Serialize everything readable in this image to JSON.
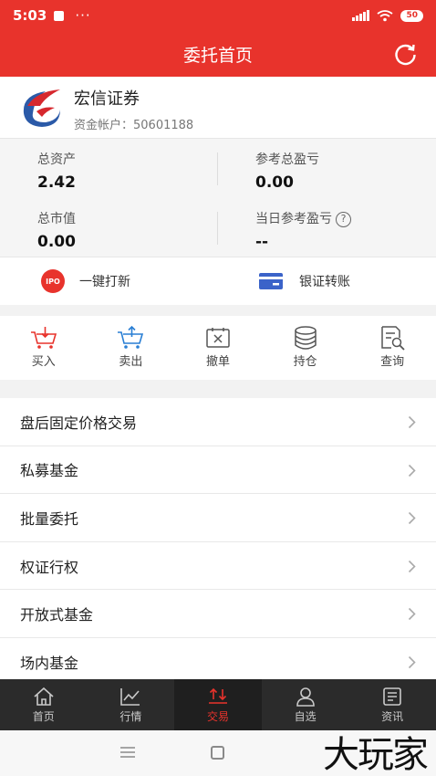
{
  "status_bar": {
    "time": "5:03",
    "dots": "···",
    "battery": "50"
  },
  "header": {
    "title": "委托首页",
    "refresh_icon": "refresh-icon"
  },
  "account": {
    "broker_name": "宏信证券",
    "account_label": "资金帐户：",
    "account_number": "50601188"
  },
  "summary": {
    "total_assets_label": "总资产",
    "total_assets_value": "2.42",
    "total_pnl_label": "参考总盈亏",
    "total_pnl_value": "0.00",
    "market_value_label": "总市值",
    "market_value_value": "0.00",
    "daily_pnl_label": "当日参考盈亏",
    "daily_pnl_value": "--",
    "help_glyph": "?"
  },
  "quick": {
    "ipo_badge": "IPO",
    "ipo_label": "一键打新",
    "bank_label": "银证转账"
  },
  "actions": [
    {
      "label": "买入",
      "icon": "buy-cart-icon"
    },
    {
      "label": "卖出",
      "icon": "sell-cart-icon"
    },
    {
      "label": "撤单",
      "icon": "cancel-order-icon"
    },
    {
      "label": "持仓",
      "icon": "holdings-icon"
    },
    {
      "label": "查询",
      "icon": "query-icon"
    }
  ],
  "menu": [
    "盘后固定价格交易",
    "私募基金",
    "批量委托",
    "权证行权",
    "开放式基金",
    "场内基金"
  ],
  "tabs": [
    {
      "label": "首页",
      "icon": "home-icon"
    },
    {
      "label": "行情",
      "icon": "chart-icon"
    },
    {
      "label": "交易",
      "icon": "trade-icon",
      "active": true
    },
    {
      "label": "自选",
      "icon": "user-icon"
    },
    {
      "label": "资讯",
      "icon": "news-icon"
    }
  ],
  "watermark": "大玩家",
  "colors": {
    "brand": "#e8332c",
    "tabbar": "#2b2b2b",
    "bank_icon": "#3b63c9"
  }
}
